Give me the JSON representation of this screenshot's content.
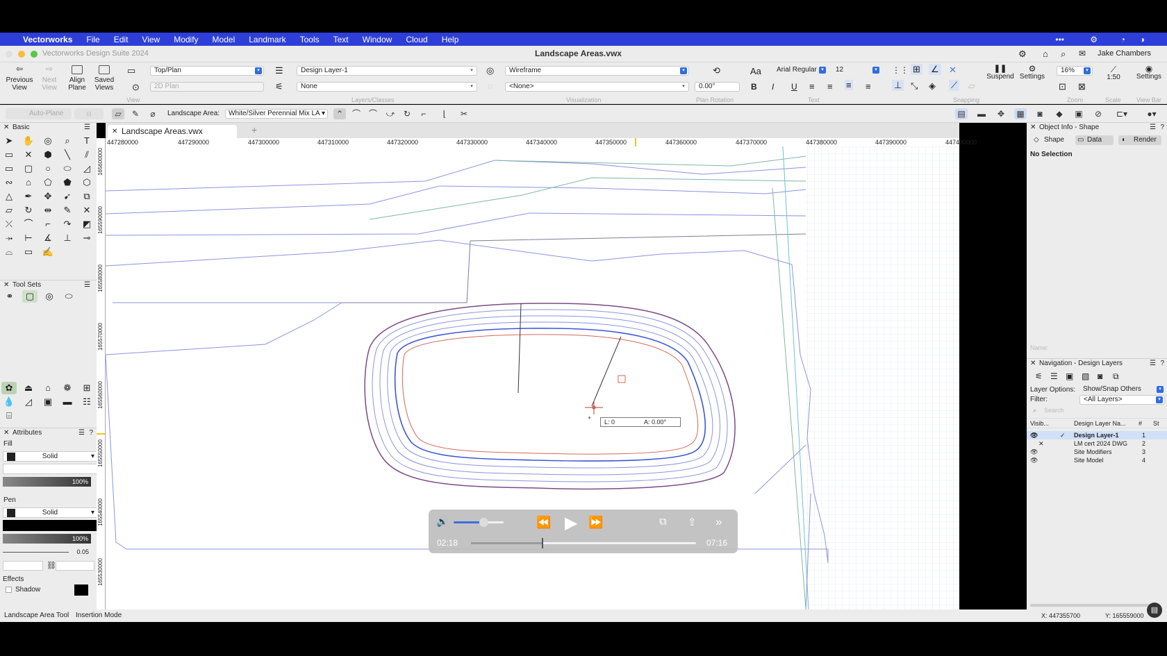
{
  "menubar": {
    "app": "Vectorworks",
    "items": [
      "File",
      "Edit",
      "View",
      "Modify",
      "Model",
      "Landmark",
      "Tools",
      "Text",
      "Window",
      "Cloud",
      "Help"
    ]
  },
  "window": {
    "app_title": "Vectorworks Design Suite 2024",
    "doc_title": "Landscape Areas.vwx",
    "user": "Jake Chambers"
  },
  "toolbar": {
    "previous_view": "Previous View",
    "next_view": "Next View",
    "align_plane": "Align Plane",
    "saved_views": "Saved Views",
    "view": "Top/Plan",
    "plane": "2D Plan",
    "view_group": "View",
    "layer": "Design Layer-1",
    "class": "None",
    "layers_group": "Layers/Classes",
    "render_mode": "Wireframe",
    "render_none": "<None>",
    "vis_group": "Visualization",
    "plan_rotation": "0.00°",
    "plan_rotation_label": "Plan Rotation",
    "font": "Arial Regular",
    "font_size": "12",
    "text_group": "Text",
    "snapping_group": "Snapping",
    "suspend": "Suspend",
    "settings": "Settings",
    "zoom": "16%",
    "zoom_group": "Zoom",
    "scale": "1:50",
    "scale_group": "Scale",
    "view_bar_settings": "Settings",
    "view_bar": "View Bar"
  },
  "modebar": {
    "auto_plane": "Auto-Plane",
    "tool_label": "Landscape Area:",
    "tool_value": "White/Silver Perennial Mix LA"
  },
  "palettes": {
    "basic": "Basic",
    "tool_sets": "Tool Sets",
    "attributes": "Attributes",
    "fill": "Fill",
    "fill_style": "Solid",
    "fill_opacity": "100%",
    "pen": "Pen",
    "pen_style": "Solid",
    "pen_opacity": "100%",
    "pen_weight": "0.05",
    "effects": "Effects",
    "shadow": "Shadow"
  },
  "doc_tab": "Landscape Areas.vwx",
  "ruler": {
    "top": [
      "447280000",
      "447290000",
      "447300000",
      "447310000",
      "447320000",
      "447330000",
      "447340000",
      "447350000",
      "447360000",
      "447370000",
      "447380000",
      "447390000",
      "447400000",
      "44"
    ],
    "left": [
      "165600000",
      "165590000",
      "165580000",
      "165570000",
      "165560000",
      "165550000",
      "165540000",
      "165530000"
    ]
  },
  "tooltip": {
    "length": "L:  0",
    "angle": "A:  0.00°"
  },
  "player": {
    "current": "02:18",
    "total": "07:16",
    "progress": 0.316,
    "volume": 0.6
  },
  "oip": {
    "title": "Object Info - Shape",
    "tabs": [
      "Shape",
      "Data",
      "Render"
    ],
    "selection": "No Selection",
    "name_label": "Name:"
  },
  "nav": {
    "title": "Navigation - Design Layers",
    "layer_options_label": "Layer Options:",
    "layer_options": "Show/Snap Others",
    "filter_label": "Filter:",
    "filter": "<All Layers>",
    "search": "Search",
    "col_vis": "Visib...",
    "col_name": "Design Layer Na...",
    "col_num": "#",
    "col_st": "St",
    "layers": [
      {
        "name": "Design Layer-1",
        "num": "1",
        "active": true
      },
      {
        "name": "LM cert 2024 DWG",
        "num": "2"
      },
      {
        "name": "Site Modifiers",
        "num": "3"
      },
      {
        "name": "Site Model",
        "num": "4"
      }
    ]
  },
  "status": {
    "tool": "Landscape Area Tool",
    "mode": "Insertion Mode",
    "x": "X: 447355700",
    "y": "Y: 165559000"
  }
}
